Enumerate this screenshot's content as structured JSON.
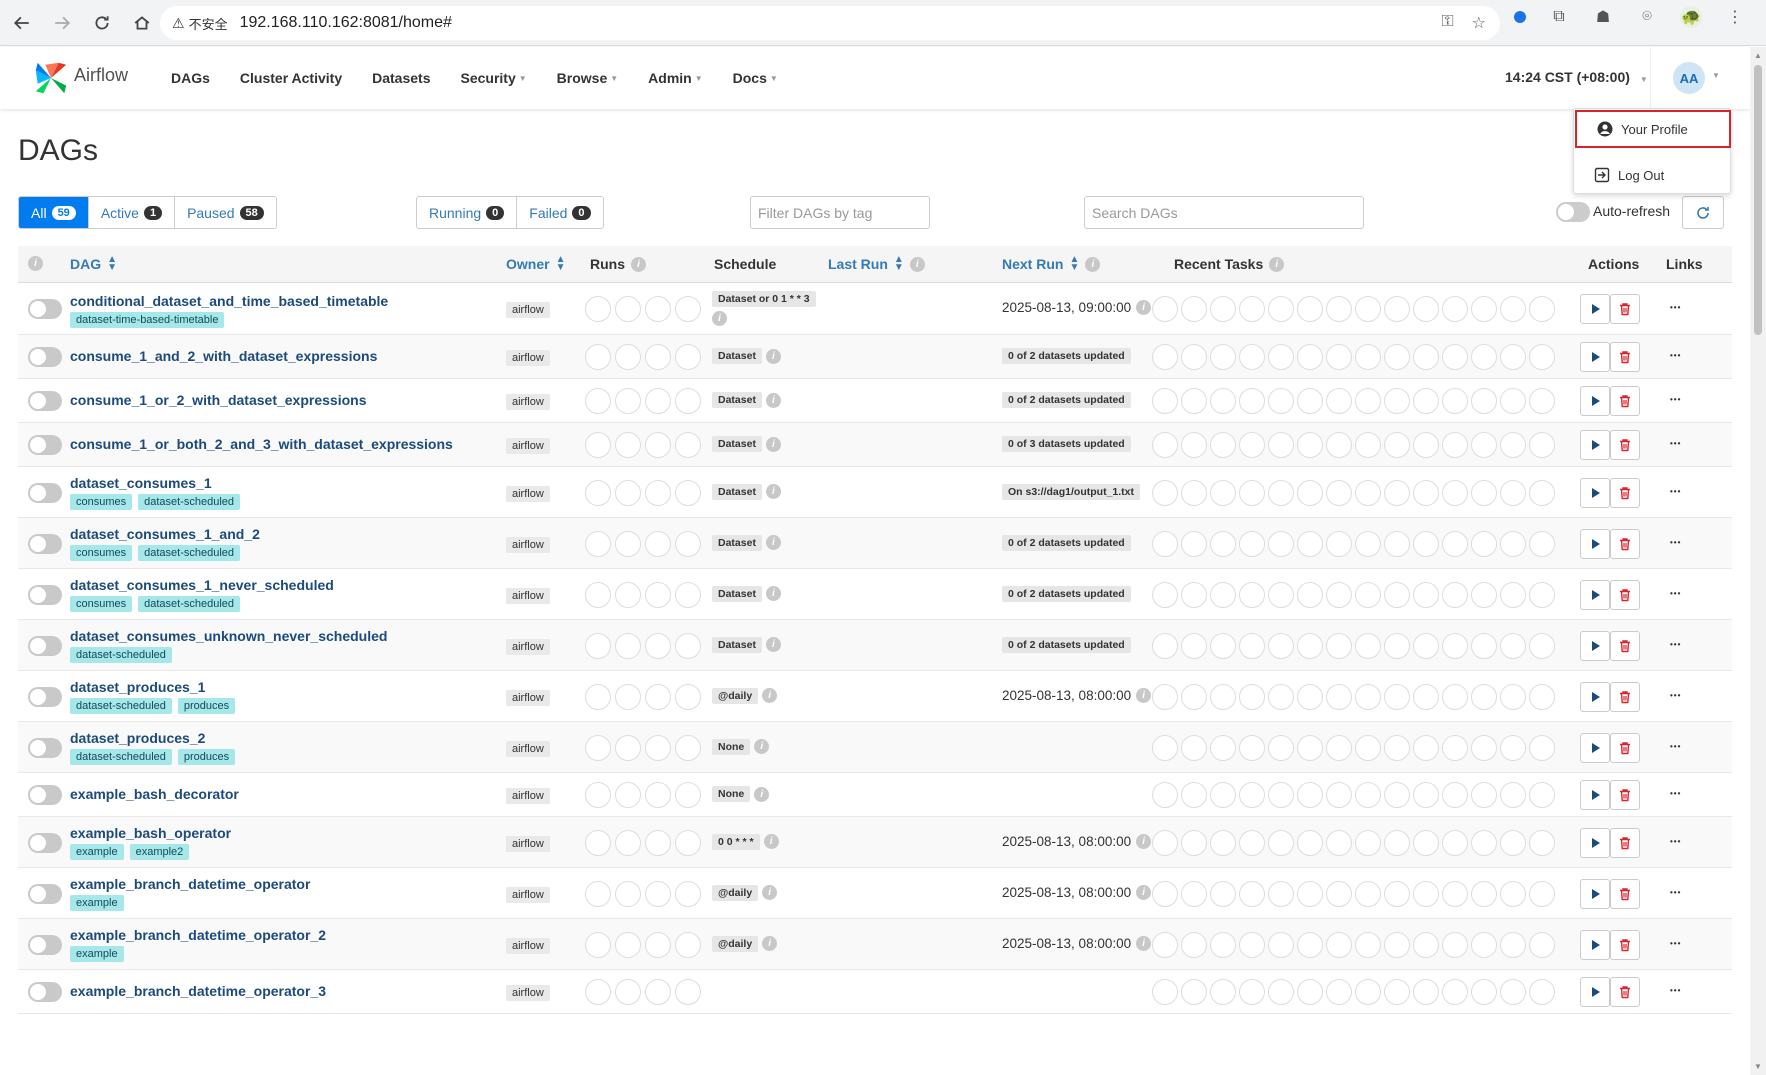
{
  "browser": {
    "insecure_label": "不安全",
    "url": "192.168.110.162:8081/home#"
  },
  "app": {
    "brand": "Airflow",
    "menu": [
      {
        "label": "DAGs",
        "dropdown": false
      },
      {
        "label": "Cluster Activity",
        "dropdown": false
      },
      {
        "label": "Datasets",
        "dropdown": false
      },
      {
        "label": "Security",
        "dropdown": true
      },
      {
        "label": "Browse",
        "dropdown": true
      },
      {
        "label": "Admin",
        "dropdown": true
      },
      {
        "label": "Docs",
        "dropdown": true
      }
    ],
    "clock": "14:24 CST (+08:00)",
    "user_initials": "AA"
  },
  "user_menu": {
    "profile_label": "Your Profile",
    "logout_label": "Log Out"
  },
  "page": {
    "title": "DAGs",
    "filters": {
      "all_label": "All",
      "all_count": "59",
      "active_label": "Active",
      "active_count": "1",
      "paused_label": "Paused",
      "paused_count": "58",
      "running_label": "Running",
      "running_count": "0",
      "failed_label": "Failed",
      "failed_count": "0"
    },
    "tag_filter_placeholder": "Filter DAGs by tag",
    "search_placeholder": "Search DAGs",
    "autorefresh_label": "Auto-refresh"
  },
  "table": {
    "headers": {
      "dag": "DAG",
      "owner": "Owner",
      "runs": "Runs",
      "schedule": "Schedule",
      "last_run": "Last Run",
      "next_run": "Next Run",
      "recent_tasks": "Recent Tasks",
      "actions": "Actions",
      "links": "Links"
    },
    "rows": [
      {
        "name": "conditional_dataset_and_time_based_timetable",
        "tags": [
          "dataset-time-based-timetable"
        ],
        "owner": "airflow",
        "schedule": "Dataset or 0 1 * * 3",
        "schedule_info_below": true,
        "next_run": "2025-08-13, 09:00:00",
        "next_run_badge": false,
        "next_info": true
      },
      {
        "name": "consume_1_and_2_with_dataset_expressions",
        "tags": [],
        "owner": "airflow",
        "schedule": "Dataset",
        "next_run": "0 of 2 datasets updated",
        "next_run_badge": true
      },
      {
        "name": "consume_1_or_2_with_dataset_expressions",
        "tags": [],
        "owner": "airflow",
        "schedule": "Dataset",
        "next_run": "0 of 2 datasets updated",
        "next_run_badge": true
      },
      {
        "name": "consume_1_or_both_2_and_3_with_dataset_expressions",
        "tags": [],
        "owner": "airflow",
        "schedule": "Dataset",
        "next_run": "0 of 3 datasets updated",
        "next_run_badge": true
      },
      {
        "name": "dataset_consumes_1",
        "tags": [
          "consumes",
          "dataset-scheduled"
        ],
        "owner": "airflow",
        "schedule": "Dataset",
        "next_run": "On s3://dag1/output_1.txt",
        "next_run_badge": true
      },
      {
        "name": "dataset_consumes_1_and_2",
        "tags": [
          "consumes",
          "dataset-scheduled"
        ],
        "owner": "airflow",
        "schedule": "Dataset",
        "next_run": "0 of 2 datasets updated",
        "next_run_badge": true
      },
      {
        "name": "dataset_consumes_1_never_scheduled",
        "tags": [
          "consumes",
          "dataset-scheduled"
        ],
        "owner": "airflow",
        "schedule": "Dataset",
        "next_run": "0 of 2 datasets updated",
        "next_run_badge": true
      },
      {
        "name": "dataset_consumes_unknown_never_scheduled",
        "tags": [
          "dataset-scheduled"
        ],
        "owner": "airflow",
        "schedule": "Dataset",
        "next_run": "0 of 2 datasets updated",
        "next_run_badge": true
      },
      {
        "name": "dataset_produces_1",
        "tags": [
          "dataset-scheduled",
          "produces"
        ],
        "owner": "airflow",
        "schedule": "@daily",
        "next_run": "2025-08-13, 08:00:00",
        "next_run_badge": false,
        "next_info": true
      },
      {
        "name": "dataset_produces_2",
        "tags": [
          "dataset-scheduled",
          "produces"
        ],
        "owner": "airflow",
        "schedule": "None",
        "next_run": "",
        "next_run_badge": false
      },
      {
        "name": "example_bash_decorator",
        "tags": [],
        "owner": "airflow",
        "schedule": "None",
        "next_run": "",
        "next_run_badge": false
      },
      {
        "name": "example_bash_operator",
        "tags": [
          "example",
          "example2"
        ],
        "owner": "airflow",
        "schedule": "0 0 * * *",
        "next_run": "2025-08-13, 08:00:00",
        "next_run_badge": false,
        "next_info": true
      },
      {
        "name": "example_branch_datetime_operator",
        "tags": [
          "example"
        ],
        "owner": "airflow",
        "schedule": "@daily",
        "next_run": "2025-08-13, 08:00:00",
        "next_run_badge": false,
        "next_info": true
      },
      {
        "name": "example_branch_datetime_operator_2",
        "tags": [
          "example"
        ],
        "owner": "airflow",
        "schedule": "@daily",
        "next_run": "2025-08-13, 08:00:00",
        "next_run_badge": false,
        "next_info": true
      },
      {
        "name": "example_branch_datetime_operator_3",
        "tags": [],
        "owner": "airflow",
        "schedule": "",
        "next_run": "",
        "next_run_badge": false
      }
    ]
  }
}
